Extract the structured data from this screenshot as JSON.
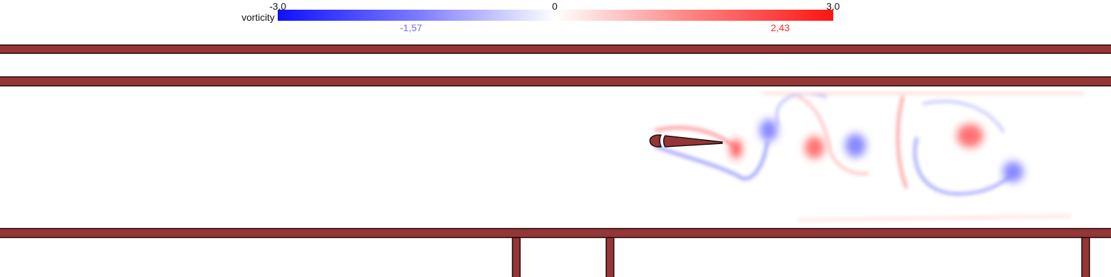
{
  "colorbar": {
    "variable": "vorticity",
    "min_label": "-3,0",
    "mid_label": "0",
    "max_label": "3,0",
    "current_min_label": "-1,57",
    "current_max_label": "2,43",
    "min_color": "#1010ff",
    "max_color": "#ff1414",
    "current_min_color": "#6b6bff",
    "current_max_color": "#ff2a2a"
  },
  "colors": {
    "wall": "#953535",
    "wall_outline": "#1a0808",
    "background": "#ffffff"
  },
  "objects": {
    "top_wall_upper": "wall",
    "top_wall_lower": "wall",
    "bottom_wall": "wall",
    "airfoil": "hydrofoil",
    "leading_edge": "rotating cylinder"
  }
}
